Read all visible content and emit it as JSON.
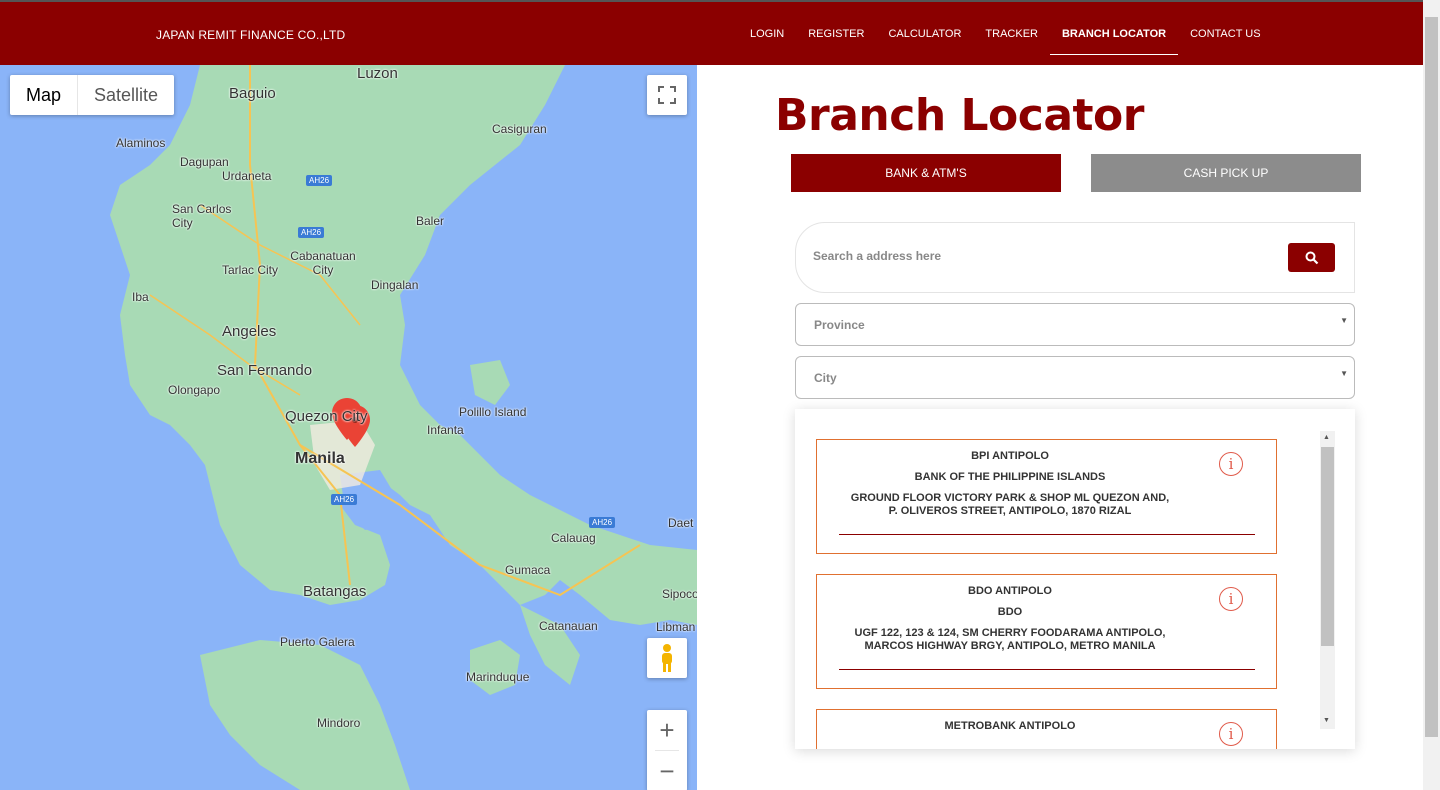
{
  "navbar": {
    "brand": "JAPAN REMIT FINANCE CO.,LTD",
    "links": [
      "LOGIN",
      "REGISTER",
      "CALCULATOR",
      "TRACKER",
      "BRANCH LOCATOR",
      "CONTACT US"
    ],
    "active": "BRANCH LOCATOR"
  },
  "map": {
    "type_options": [
      "Map",
      "Satellite"
    ],
    "active_type": "Map",
    "labels": [
      "Luzon",
      "Baguio",
      "Casiguran",
      "Alaminos",
      "Dagupan",
      "Urdaneta",
      "San Carlos City",
      "Baler",
      "Cabanatuan City",
      "Tarlac City",
      "Dingalan",
      "Iba",
      "Angeles",
      "San Fernando",
      "Olongapo",
      "Quezon City",
      "Polillo Island",
      "Infanta",
      "Manila",
      "Calauag",
      "Daet",
      "Gumaca",
      "Batangas",
      "Sipoco",
      "Catanauan",
      "Libman",
      "Puerto Galera",
      "Marinduque",
      "Mindoro"
    ],
    "road_badges": [
      "AH26",
      "AH26",
      "AH26",
      "AH26"
    ],
    "zoom_in": "+",
    "zoom_out": "−"
  },
  "panel": {
    "title": "Branch Locator",
    "tabs": {
      "bank": "BANK & ATM'S",
      "cash": "CASH PICK UP"
    },
    "search": {
      "placeholder": "Search a address here"
    },
    "province": {
      "placeholder": "Province"
    },
    "city": {
      "placeholder": "City"
    },
    "results": [
      {
        "name": "BPI ANTIPOLO",
        "bank": "BANK OF THE PHILIPPINE ISLANDS",
        "address_line1": "GROUND FLOOR VICTORY PARK & SHOP ML QUEZON AND,",
        "address_line2": "P. OLIVEROS STREET, ANTIPOLO, 1870 RIZAL"
      },
      {
        "name": "BDO ANTIPOLO",
        "bank": "BDO",
        "address_line1": "UGF 122, 123 & 124, SM CHERRY FOODARAMA ANTIPOLO,",
        "address_line2": "MARCOS HIGHWAY BRGY, ANTIPOLO, METRO MANILA"
      },
      {
        "name": "METROBANK ANTIPOLO",
        "bank": "",
        "address_line1": "",
        "address_line2": ""
      }
    ]
  },
  "colors": {
    "brand": "#8b0000",
    "secondary_tab": "#8c8c8c",
    "card_border": "#e07030",
    "map_water": "#8ab4f8",
    "map_land": "#a8dab5"
  }
}
